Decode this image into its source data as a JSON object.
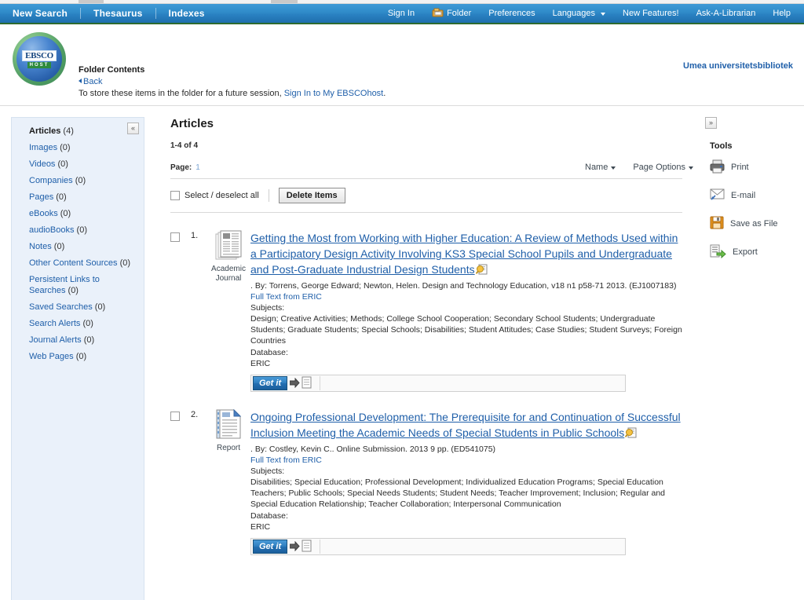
{
  "top_nav": {
    "left_items": [
      {
        "label": "New Search",
        "name": "nav-new-search"
      },
      {
        "label": "Thesaurus",
        "name": "nav-thesaurus"
      },
      {
        "label": "Indexes",
        "name": "nav-indexes"
      }
    ],
    "right_items": [
      {
        "label": "Sign In",
        "name": "nav-sign-in",
        "icon": null,
        "caret": false
      },
      {
        "label": "Folder",
        "name": "nav-folder",
        "icon": "folder-icon",
        "caret": false
      },
      {
        "label": "Preferences",
        "name": "nav-preferences",
        "icon": null,
        "caret": false
      },
      {
        "label": "Languages",
        "name": "nav-languages",
        "icon": null,
        "caret": true
      },
      {
        "label": "New Features!",
        "name": "nav-new-features",
        "icon": null,
        "caret": false
      },
      {
        "label": "Ask-A-Librarian",
        "name": "nav-ask-a-librarian",
        "icon": null,
        "caret": false
      },
      {
        "label": "Help",
        "name": "nav-help",
        "icon": null,
        "caret": false
      }
    ],
    "accent_color": "#2a82c2",
    "underline_color": "#2e6b2e"
  },
  "header": {
    "logo_word": "EBSCO",
    "logo_sub": "HOST",
    "title": "Folder Contents",
    "back_label": "Back",
    "store_text_before": "To store these items in the folder for a future session, ",
    "store_link": "Sign In to My EBSCOhost",
    "store_text_after": ".",
    "institution": "Umea universitetsbibliotek"
  },
  "sidebar": {
    "collapse_glyph": "«",
    "items": [
      {
        "label": "Articles",
        "count": "(4)",
        "active": true,
        "name": "sidebar-item-articles"
      },
      {
        "label": "Images",
        "count": "(0)",
        "active": false,
        "name": "sidebar-item-images"
      },
      {
        "label": "Videos",
        "count": "(0)",
        "active": false,
        "name": "sidebar-item-videos"
      },
      {
        "label": "Companies",
        "count": "(0)",
        "active": false,
        "name": "sidebar-item-companies"
      },
      {
        "label": "Pages",
        "count": "(0)",
        "active": false,
        "name": "sidebar-item-pages"
      },
      {
        "label": "eBooks",
        "count": "(0)",
        "active": false,
        "name": "sidebar-item-ebooks"
      },
      {
        "label": "audioBooks",
        "count": "(0)",
        "active": false,
        "name": "sidebar-item-audiobooks"
      },
      {
        "label": "Notes",
        "count": "(0)",
        "active": false,
        "name": "sidebar-item-notes"
      },
      {
        "label": "Other Content Sources",
        "count": "(0)",
        "active": false,
        "name": "sidebar-item-other-content-sources"
      },
      {
        "label": "Persistent Links to Searches",
        "count": "(0)",
        "active": false,
        "name": "sidebar-item-persistent-links-to-searches"
      },
      {
        "label": "Saved Searches",
        "count": "(0)",
        "active": false,
        "name": "sidebar-item-saved-searches"
      },
      {
        "label": "Search Alerts",
        "count": "(0)",
        "active": false,
        "name": "sidebar-item-search-alerts"
      },
      {
        "label": "Journal Alerts",
        "count": "(0)",
        "active": false,
        "name": "sidebar-item-journal-alerts"
      },
      {
        "label": "Web Pages",
        "count": "(0)",
        "active": false,
        "name": "sidebar-item-web-pages"
      }
    ]
  },
  "main": {
    "title": "Articles",
    "result_range": "1-4 of 4",
    "page_label": "Page:",
    "page_number": "1",
    "sort_label": "Name",
    "page_options_label": "Page Options",
    "select_all_label": "Select / deselect all",
    "delete_label": "Delete Items",
    "section_labels": {
      "subjects": "Subjects:",
      "database": "Database:"
    },
    "getit_label": "Get it",
    "results": [
      {
        "number": "1.",
        "type_line1": "Academic",
        "type_line2": "Journal",
        "type_icon": "academic-journal-icon",
        "title": "Getting the Most from Working with Higher Education: A Review of Methods Used within a Participatory Design Activity Involving KS3 Special School Pupils and Undergraduate and Post-Graduate Industrial Design Students",
        "meta": ". By: Torrens, George Edward; Newton, Helen. Design and Technology Education, v18 n1 p58-71 2013. (EJ1007183)",
        "full_text_link": "Full Text from ERIC",
        "subjects": "Design; Creative Activities; Methods; College School Cooperation; Secondary School Students; Undergraduate Students; Graduate Students; Special Schools; Disabilities; Student Attitudes; Case Studies; Student Surveys; Foreign Countries",
        "database": "ERIC"
      },
      {
        "number": "2.",
        "type_line1": "Report",
        "type_line2": "",
        "type_icon": "report-icon",
        "title": "Ongoing Professional Development: The Prerequisite for and Continuation of Successful Inclusion Meeting the Academic Needs of Special Students in Public Schools",
        "meta": ". By: Costley, Kevin C.. Online Submission. 2013 9 pp. (ED541075)",
        "full_text_link": "Full Text from ERIC",
        "subjects": "Disabilities; Special Education; Professional Development; Individualized Education Programs; Special Education Teachers; Public Schools; Special Needs Students; Student Needs; Teacher Improvement; Inclusion; Regular and Special Education Relationship; Teacher Collaboration; Interpersonal Communication",
        "database": "ERIC"
      }
    ]
  },
  "tools": {
    "expand_glyph": "»",
    "title": "Tools",
    "items": [
      {
        "label": "Print",
        "icon": "printer-icon",
        "name": "tool-print"
      },
      {
        "label": "E-mail",
        "icon": "envelope-icon",
        "name": "tool-email"
      },
      {
        "label": "Save as File",
        "icon": "floppy-disk-icon",
        "name": "tool-save-as-file"
      },
      {
        "label": "Export",
        "icon": "export-icon",
        "name": "tool-export"
      }
    ]
  }
}
